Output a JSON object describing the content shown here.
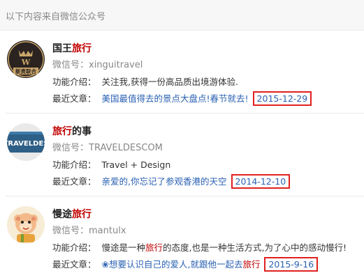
{
  "header": {
    "text": "以下内容来自微信公众号"
  },
  "results": [
    {
      "title_pre": "国王",
      "title_hl": "旅行",
      "title_post": "",
      "wechat_id": "微信号：xinguitravel",
      "intro_label": "功能介绍：",
      "intro": "关注我,获得一份高品质出境游体验.",
      "recent_label": "最近文章：",
      "article_pre": "美国最值得去的景点大盘点!春节就去!",
      "article_hl": "",
      "date": "2015-12-29",
      "avatar_text": "新贵联合",
      "avatar_colors": {
        "bg": "#2a2320",
        "accent": "#c9a56a"
      }
    },
    {
      "title_pre": "",
      "title_hl": "旅行",
      "title_post": "的事",
      "wechat_id": "微信号：TRAVELDESCOM",
      "intro_label": "功能介绍：",
      "intro": "Travel + Design",
      "recent_label": "最近文章：",
      "article_pre": "亲爱的,你忘记了参观香港的天空",
      "article_hl": "",
      "date": "2014-12-10",
      "avatar_text": "TRAVELDES",
      "avatar_colors": {
        "bg": "#2e5f86",
        "accent": "#ffffff"
      }
    },
    {
      "title_pre": "慢途",
      "title_hl": "旅行",
      "title_post": "",
      "wechat_id": "微信号：mantulx",
      "intro_label": "功能介绍：",
      "intro_pre": "慢途是一种",
      "intro_hl": "旅行",
      "intro_post": "的态度,也是一种生活方式,为了心中的感动慢行!",
      "recent_label": "最近文章：",
      "article_pre": "❀想要认识自己的爱人,就跟他一起去",
      "article_hl": "旅行",
      "date": "2015-9-16",
      "avatar_colors": {
        "bg": "#f5e6c8",
        "accent": "#e8a33a"
      }
    }
  ]
}
